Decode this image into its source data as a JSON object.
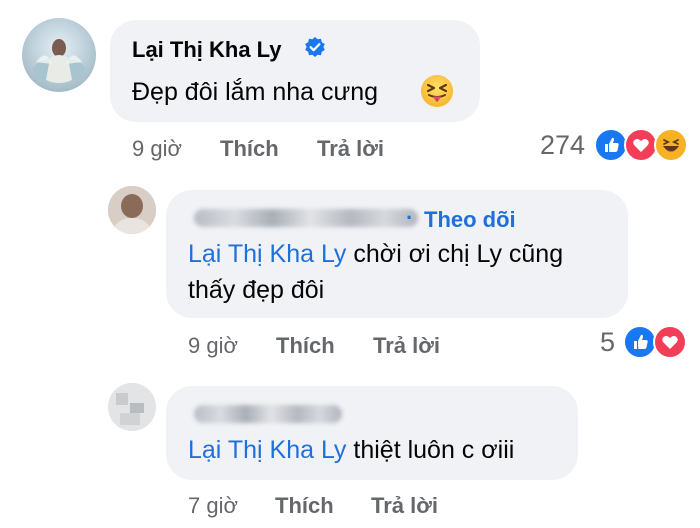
{
  "colors": {
    "mention": "#216fdb",
    "meta": "#65676b",
    "bubble": "#f0f2f5",
    "verified": "#1877f2"
  },
  "comment_1": {
    "author": "Lại Thị Kha Ly",
    "verified_icon": "verified-badge-icon",
    "text": "Đẹp đôi lắm nha cưng",
    "emoji": "squinting-tongue-emoji",
    "time": "9 giờ",
    "like": "Thích",
    "reply": "Trả lời",
    "reaction_count": "274",
    "reactions": [
      "like-reaction-icon",
      "love-reaction-icon",
      "haha-reaction-icon"
    ]
  },
  "reply_1": {
    "follow_separator": "·",
    "follow_label": "Theo dõi",
    "mention": "Lại Thị Kha Ly",
    "text_line1": "chời ơi chị Ly cũng",
    "text_line2": "thấy đẹp đôi",
    "time": "9 giờ",
    "like": "Thích",
    "reply": "Trả lời",
    "reaction_count": "5",
    "reactions": [
      "like-reaction-icon",
      "love-reaction-icon"
    ]
  },
  "reply_2": {
    "mention": "Lại Thị Kha Ly",
    "text": "thiệt luôn c ơiii",
    "time": "7 giờ",
    "like": "Thích",
    "reply": "Trả lời"
  }
}
